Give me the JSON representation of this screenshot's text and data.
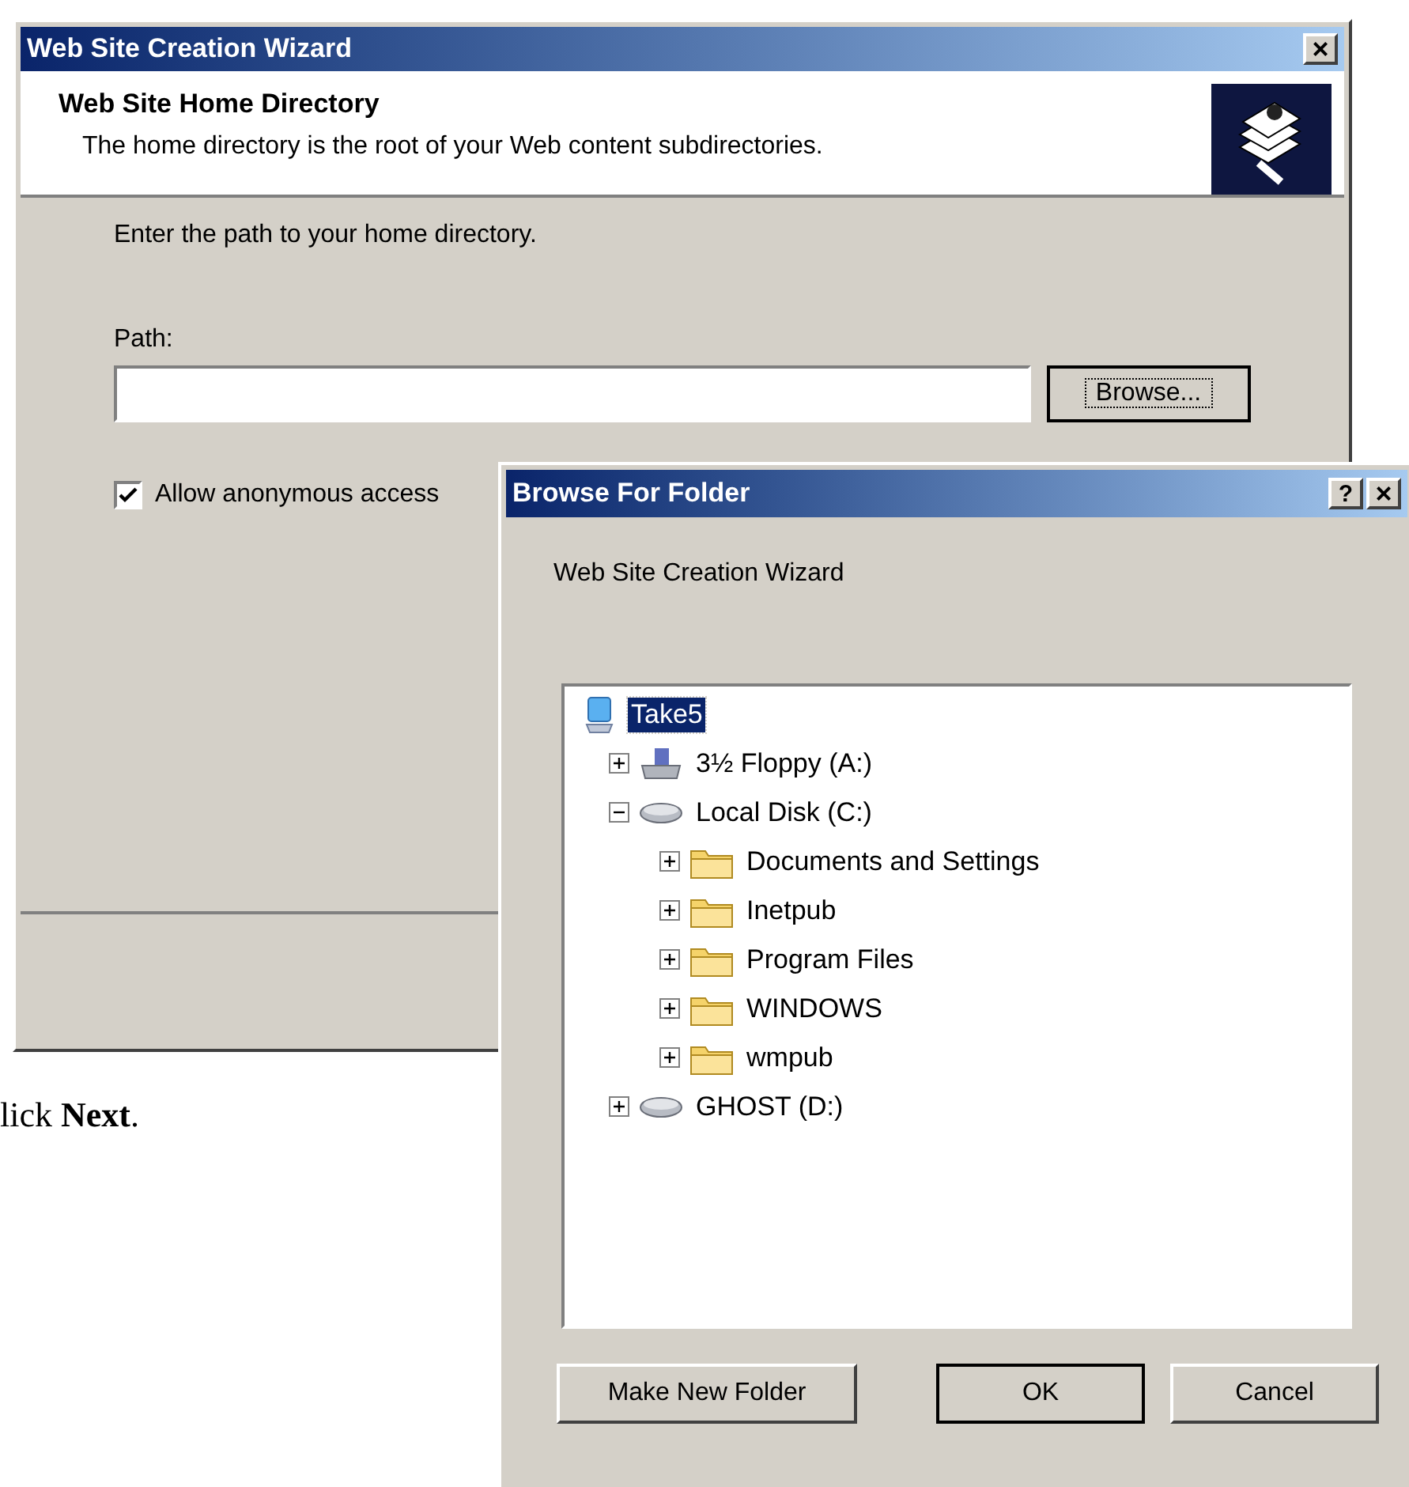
{
  "page_text": "lick **Next**.",
  "wizard": {
    "title": "Web Site Creation Wizard",
    "close": "×",
    "heading": "Web Site Home Directory",
    "subheading": "The home directory is the root of your Web content subdirectories.",
    "prompt": "Enter the path to your home directory.",
    "path_label": "Path:",
    "browse_button": "Browse...",
    "anonymous": {
      "label": "Allow anonymous access",
      "checked": true
    }
  },
  "browse_dialog": {
    "title": "Browse For Folder",
    "help": "?",
    "close": "×",
    "description": "Web Site Creation Wizard",
    "tree": [
      {
        "label": "Take5",
        "kind": "computer",
        "selected": true,
        "children": [
          {
            "label": "3½ Floppy (A:)",
            "kind": "floppy",
            "selected": false,
            "expanded": false
          },
          {
            "label": "Local Disk (C:)",
            "kind": "disk",
            "selected": false,
            "expanded": true,
            "children": [
              {
                "label": "Documents and Settings",
                "kind": "folder",
                "selected": false,
                "expanded": false
              },
              {
                "label": "Inetpub",
                "kind": "folder",
                "selected": false,
                "expanded": false
              },
              {
                "label": "Program Files",
                "kind": "folder",
                "selected": false,
                "expanded": false
              },
              {
                "label": "WINDOWS",
                "kind": "folder",
                "selected": false,
                "expanded": false
              },
              {
                "label": "wmpub",
                "kind": "folder",
                "selected": false,
                "expanded": false
              }
            ]
          },
          {
            "label": "GHOST (D:)",
            "kind": "disk",
            "selected": false,
            "expanded": false
          }
        ]
      }
    ],
    "buttons": [
      {
        "label": "Make New Folder",
        "default": false
      },
      {
        "label": "OK",
        "default": true
      },
      {
        "label": "Cancel",
        "default": false
      }
    ]
  }
}
